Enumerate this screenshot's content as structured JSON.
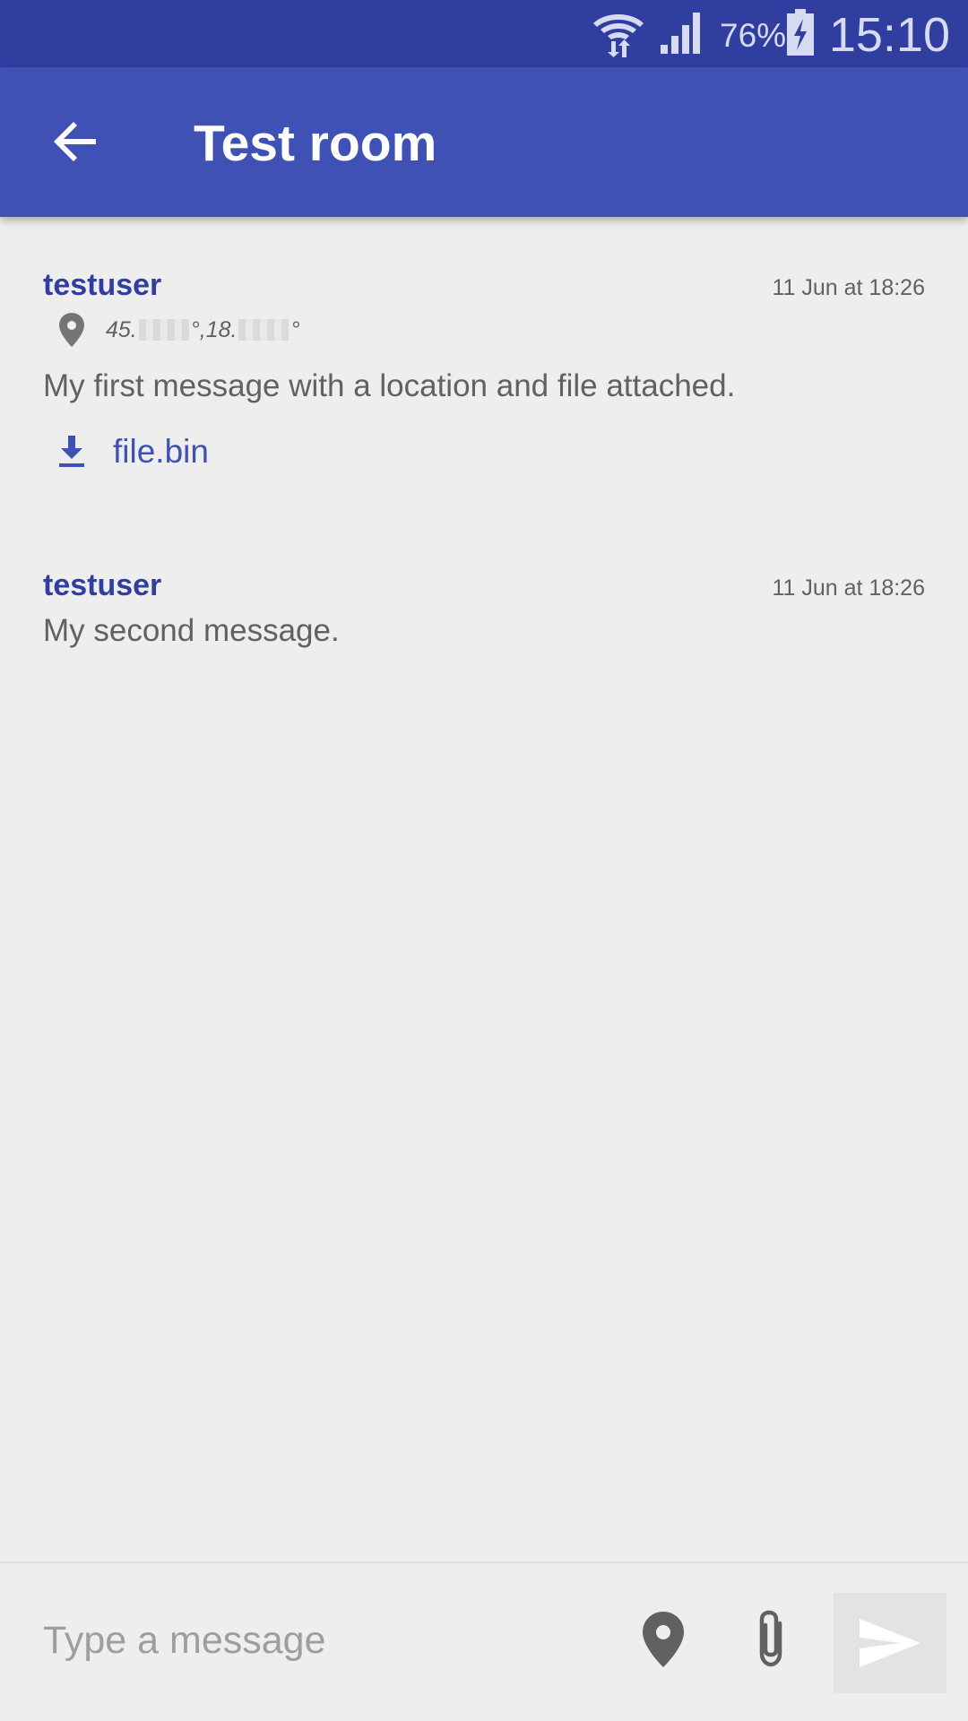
{
  "status_bar": {
    "battery_percent": "76%",
    "time": "15:10",
    "icons": [
      "wifi-icon",
      "signal-icon",
      "battery-charging-icon"
    ]
  },
  "app_bar": {
    "title": "Test room",
    "back_icon": "arrow-back-icon"
  },
  "messages": [
    {
      "author": "testuser",
      "timestamp": "11 Jun at 18:26",
      "location": {
        "lat_prefix": "45.",
        "lng_prefix": "18.",
        "separator": "°, ",
        "suffix": "°"
      },
      "text": "My first message with a location and file attached.",
      "attachment": "file.bin"
    },
    {
      "author": "testuser",
      "timestamp": "11 Jun at 18:26",
      "text": "My second message."
    }
  ],
  "composer": {
    "placeholder": "Type a message",
    "value": "",
    "icons": [
      "location-pin-icon",
      "paperclip-icon",
      "send-icon"
    ]
  },
  "colors": {
    "status_bar": "#303F9F",
    "app_bar": "#3F51B5",
    "author": "#303F9F",
    "link": "#3F51B5",
    "background": "#EEEEEE",
    "text": "#616161"
  }
}
